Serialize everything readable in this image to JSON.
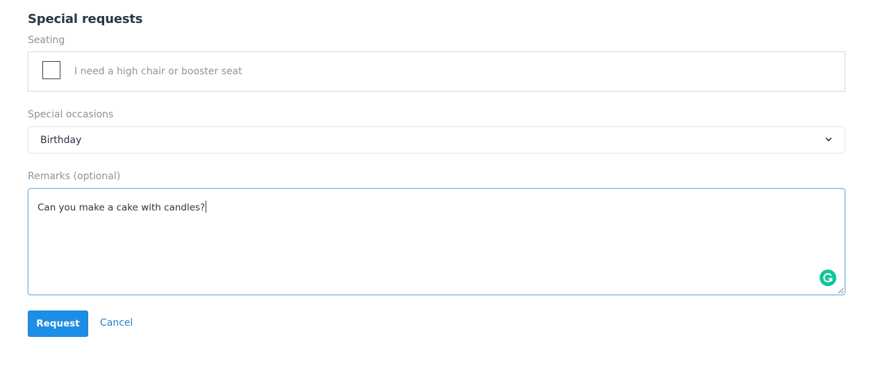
{
  "form": {
    "section_title": "Special requests",
    "seating": {
      "label": "Seating",
      "checkbox_label": "I need a high chair or booster seat",
      "checked": false
    },
    "occasions": {
      "label": "Special occasions",
      "selected": "Birthday"
    },
    "remarks": {
      "label": "Remarks (optional)",
      "value": "Can you make a cake with candles?"
    },
    "actions": {
      "request_label": "Request",
      "cancel_label": "Cancel"
    }
  },
  "icons": {
    "chevron": "chevron-down-icon",
    "grammarly": "grammarly-icon",
    "resize": "resize-handle-icon"
  },
  "colors": {
    "primary": "#1c8ee5",
    "link": "#2a80c3",
    "focus_border": "#63aee8",
    "grammarly": "#15c39a"
  }
}
